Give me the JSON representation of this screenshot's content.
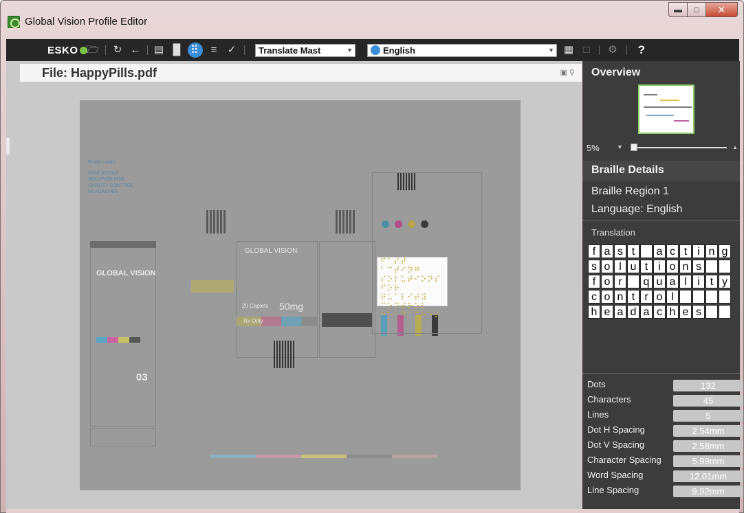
{
  "window": {
    "title": "Global Vision Profile Editor"
  },
  "toolbar": {
    "logo": "ESKO",
    "profile_select": "Translate Mast",
    "language_select": "English",
    "help": "?"
  },
  "document": {
    "file_title": "File: HappyPills.pdf"
  },
  "overview": {
    "title": "Overview",
    "zoom": "5%"
  },
  "braille_details": {
    "title": "Braille Details",
    "region": "Braille Region 1",
    "language": "Language: English",
    "translation_label": "Translation",
    "translation_rows": [
      [
        "f",
        "a",
        "s",
        "t",
        " ",
        "a",
        "c",
        "t",
        "i",
        "n",
        "g"
      ],
      [
        "s",
        "o",
        "l",
        "u",
        "t",
        "i",
        "o",
        "n",
        "s",
        " ",
        " "
      ],
      [
        "f",
        "o",
        "r",
        " ",
        "q",
        "u",
        "a",
        "l",
        "i",
        "t",
        "y"
      ],
      [
        "c",
        "o",
        "n",
        "t",
        "r",
        "o",
        "l",
        " ",
        " ",
        " ",
        " "
      ],
      [
        "h",
        "e",
        "a",
        "d",
        "a",
        "c",
        "h",
        "e",
        "s",
        " ",
        " "
      ]
    ]
  },
  "stats": [
    {
      "label": "Dots",
      "value": "132"
    },
    {
      "label": "Characters",
      "value": "45"
    },
    {
      "label": "Lines",
      "value": "5"
    },
    {
      "label": "Dot H Spacing",
      "value": "2.54mm"
    },
    {
      "label": "Dot V Spacing",
      "value": "2.58mm"
    },
    {
      "label": "Character Spacing",
      "value": "5.99mm"
    },
    {
      "label": "Word Spacing",
      "value": "12.01mm"
    },
    {
      "label": "Line Spacing",
      "value": "9.92mm"
    }
  ],
  "artwork": {
    "braille_heading": "Braille reads:",
    "braille_lines": [
      "FAST ACTING",
      "SOLUTION FOR",
      "QUALITY CONTROL",
      "HEADACHES"
    ],
    "brand": "GLOBAL VISION",
    "brand_center": "GLOBAL VISION",
    "caplets": "20 Caplets",
    "dose": "50mg",
    "rx": "Rx Only",
    "lot": "03"
  },
  "colors": {
    "toolbar_bg": "#262626",
    "panel_bg": "#3c3c3c",
    "accent_blue": "#3a8fd8",
    "braille_dot": "#d1a93a"
  }
}
